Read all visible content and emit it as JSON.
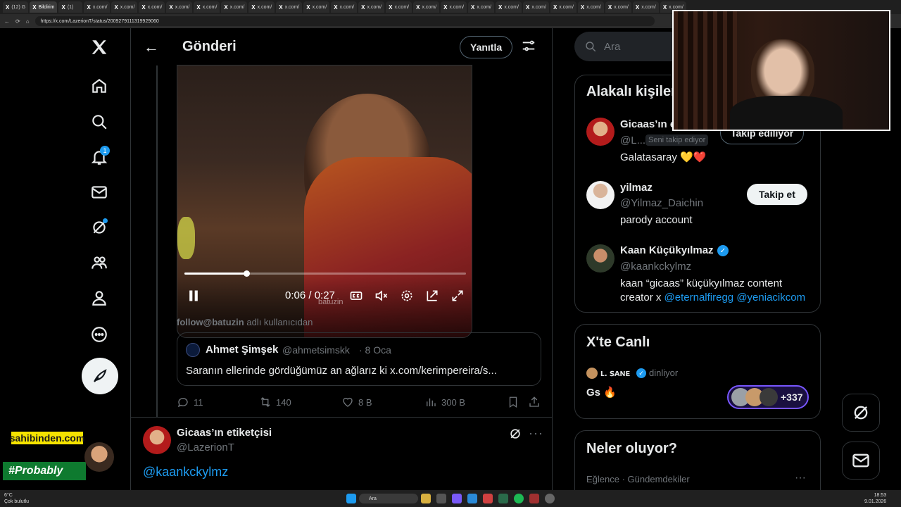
{
  "browser": {
    "tabs": [
      "(12) G",
      "Bildirim",
      "(1)",
      "x.com/",
      "x.com/",
      "x.com/",
      "x.com/",
      "x.com/",
      "x.com/",
      "x.com/",
      "x.com/",
      "x.com/",
      "x.com/",
      "x.com/",
      "x.com/",
      "x.com/",
      "x.com/",
      "x.com/",
      "x.com/",
      "x.com/",
      "x.com/",
      "x.com/",
      "x.com/",
      "x.com/",
      "x.com/"
    ],
    "url": "https://x.com/LazerionT/status/2009279111319929060"
  },
  "nav": {
    "notification_count": "1"
  },
  "header": {
    "title": "Gönderi",
    "reply_button": "Yanıtla"
  },
  "video": {
    "time": "0:06 / 0:27",
    "progress_fraction": 0.22,
    "watermark": "batuzin"
  },
  "credit": {
    "handle": "follow@batuzin",
    "suffix": "adlı kullanıcıdan"
  },
  "quote": {
    "name": "Ahmet Şimşek",
    "handle": "@ahmetsimskk",
    "date": "· 8 Oca",
    "text": "Saranın ellerinde gördüğümüz an ağlarız ki x.com/kerimpereira/s..."
  },
  "actions": {
    "replies": "11",
    "reposts": "140",
    "likes": "8 B",
    "views": "300 B"
  },
  "reply": {
    "name": "Gicaas’ın etiketçisi",
    "handle": "@LazerionT",
    "text": "@kaankckylmz"
  },
  "overlay": {
    "sponsor": "sahibinden.com",
    "tag": "#Probably"
  },
  "search": {
    "placeholder": "Ara"
  },
  "related": {
    "title": "Alakalı kişiler",
    "people": [
      {
        "name": "Gicaas’ın e",
        "handle": "@L...",
        "chip": "Seni takip ediyor",
        "button": "Takip ediliyor",
        "bio": "Galatasaray 💛❤️"
      },
      {
        "name": "yilmaz",
        "handle": "@Yilmaz_Daichin",
        "button": "Takip et",
        "bio": "parody account"
      },
      {
        "name": "Kaan Küçükyılmaz",
        "handle": "@kaankckylmz",
        "bio_text": "kaan “gicaas” küçükyılmaz content creator x",
        "bio_links": [
          "@eternalfiregg",
          "@yeniacikcom"
        ]
      }
    ]
  },
  "live": {
    "title": "X'te Canlı",
    "host": "ʟ. ꜱᴀɴᴇ",
    "status": "dinliyor",
    "space_title": "Gs 🔥",
    "listeners": "+337"
  },
  "trending": {
    "title": "Neler oluyor?",
    "category": "Eğlence · Gündemdekiler"
  },
  "taskbar": {
    "weather_temp": "6°C",
    "weather_desc": "Çok bulutlu",
    "search": "Ara",
    "time": "18:53",
    "date": "9.01.2026"
  },
  "colors": {
    "accent": "#1d9bf0",
    "border": "#2f3336",
    "muted": "#71767b"
  }
}
